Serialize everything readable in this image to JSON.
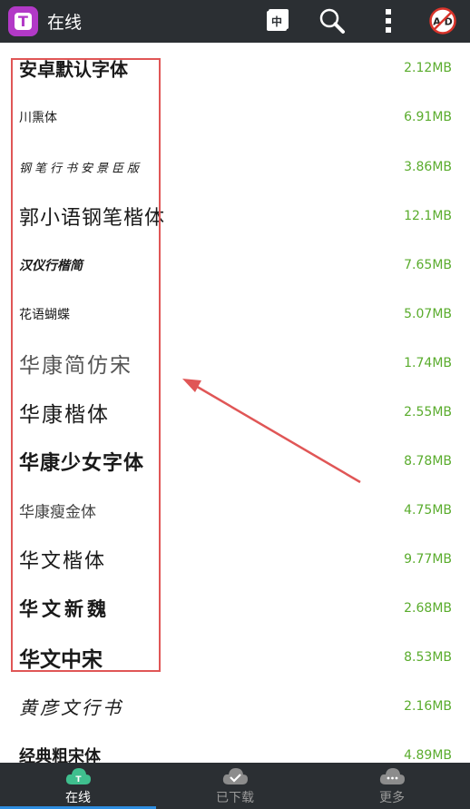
{
  "header": {
    "title": "在线",
    "logo_letter": "T",
    "lang_button": "中",
    "ad_badge": "A D",
    "icons": [
      "chinese-language-icon",
      "search-icon",
      "more-vertical-icon",
      "no-ads-icon"
    ]
  },
  "fonts": [
    {
      "name": "安卓默认字体",
      "size": "2.12MB"
    },
    {
      "name": "川熏体",
      "size": "6.91MB"
    },
    {
      "name": "钢笔行书安景臣版",
      "size": "3.86MB"
    },
    {
      "name": "郭小语钢笔楷体",
      "size": "12.1MB"
    },
    {
      "name": "汉仪行楷简",
      "size": "7.65MB"
    },
    {
      "name": "花语蝴蝶",
      "size": "5.07MB"
    },
    {
      "name": "华康简仿宋",
      "size": "1.74MB"
    },
    {
      "name": "华康楷体",
      "size": "2.55MB"
    },
    {
      "name": "华康少女字体",
      "size": "8.78MB"
    },
    {
      "name": "华康瘦金体",
      "size": "4.75MB"
    },
    {
      "name": "华文楷体",
      "size": "9.77MB"
    },
    {
      "name": "华文新魏",
      "size": "2.68MB"
    },
    {
      "name": "华文中宋",
      "size": "8.53MB"
    },
    {
      "name": "黄彦文行书",
      "size": "2.16MB"
    },
    {
      "name": "经典粗宋体",
      "size": "4.89MB"
    }
  ],
  "tabs": [
    {
      "label": "在线",
      "icon": "cloud-t-icon",
      "active": true
    },
    {
      "label": "已下载",
      "icon": "cloud-check-icon",
      "active": false
    },
    {
      "label": "更多",
      "icon": "cloud-more-icon",
      "active": false
    }
  ],
  "colors": {
    "accent_green": "#5aac2d",
    "topbar": "#2b2f33",
    "logo_purple": "#b239c7",
    "annotation_red": "#e05656",
    "tab_indicator": "#2d8de0"
  }
}
